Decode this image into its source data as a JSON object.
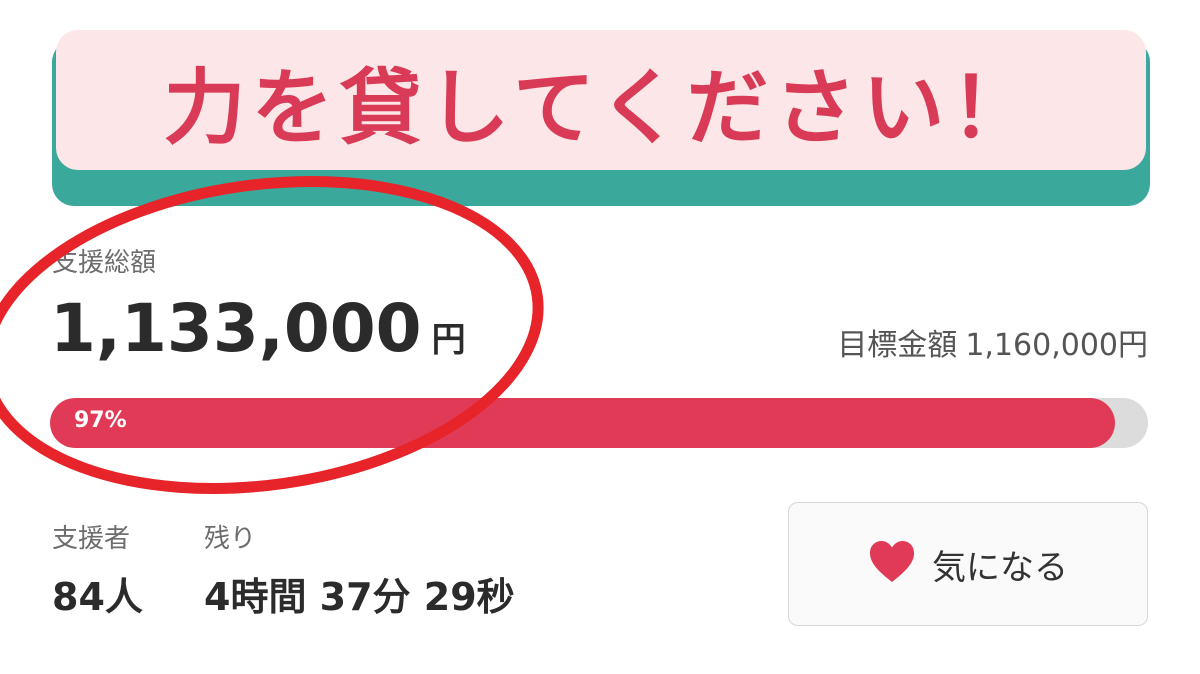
{
  "banner": {
    "text": "力を貸してください！"
  },
  "funding": {
    "raised_label": "支援総額",
    "raised_amount": "1,133,000",
    "currency": "円",
    "goal_label": "目標金額",
    "goal_amount": "1,160,000円",
    "progress_text": "97%",
    "progress_percent": 97
  },
  "stats": {
    "supporters_label": "支援者",
    "supporters_value": "84人",
    "remaining_label": "残り",
    "remaining_value": "4時間 37分 29秒"
  },
  "favorite_button": {
    "label": "気になる",
    "icon": "heart-icon"
  },
  "colors": {
    "accent": "#e03a57",
    "banner_bg": "#fde6e8",
    "banner_text": "#d93a56",
    "banner_shadow": "#3aa89b",
    "annotation": "#e8242b"
  }
}
